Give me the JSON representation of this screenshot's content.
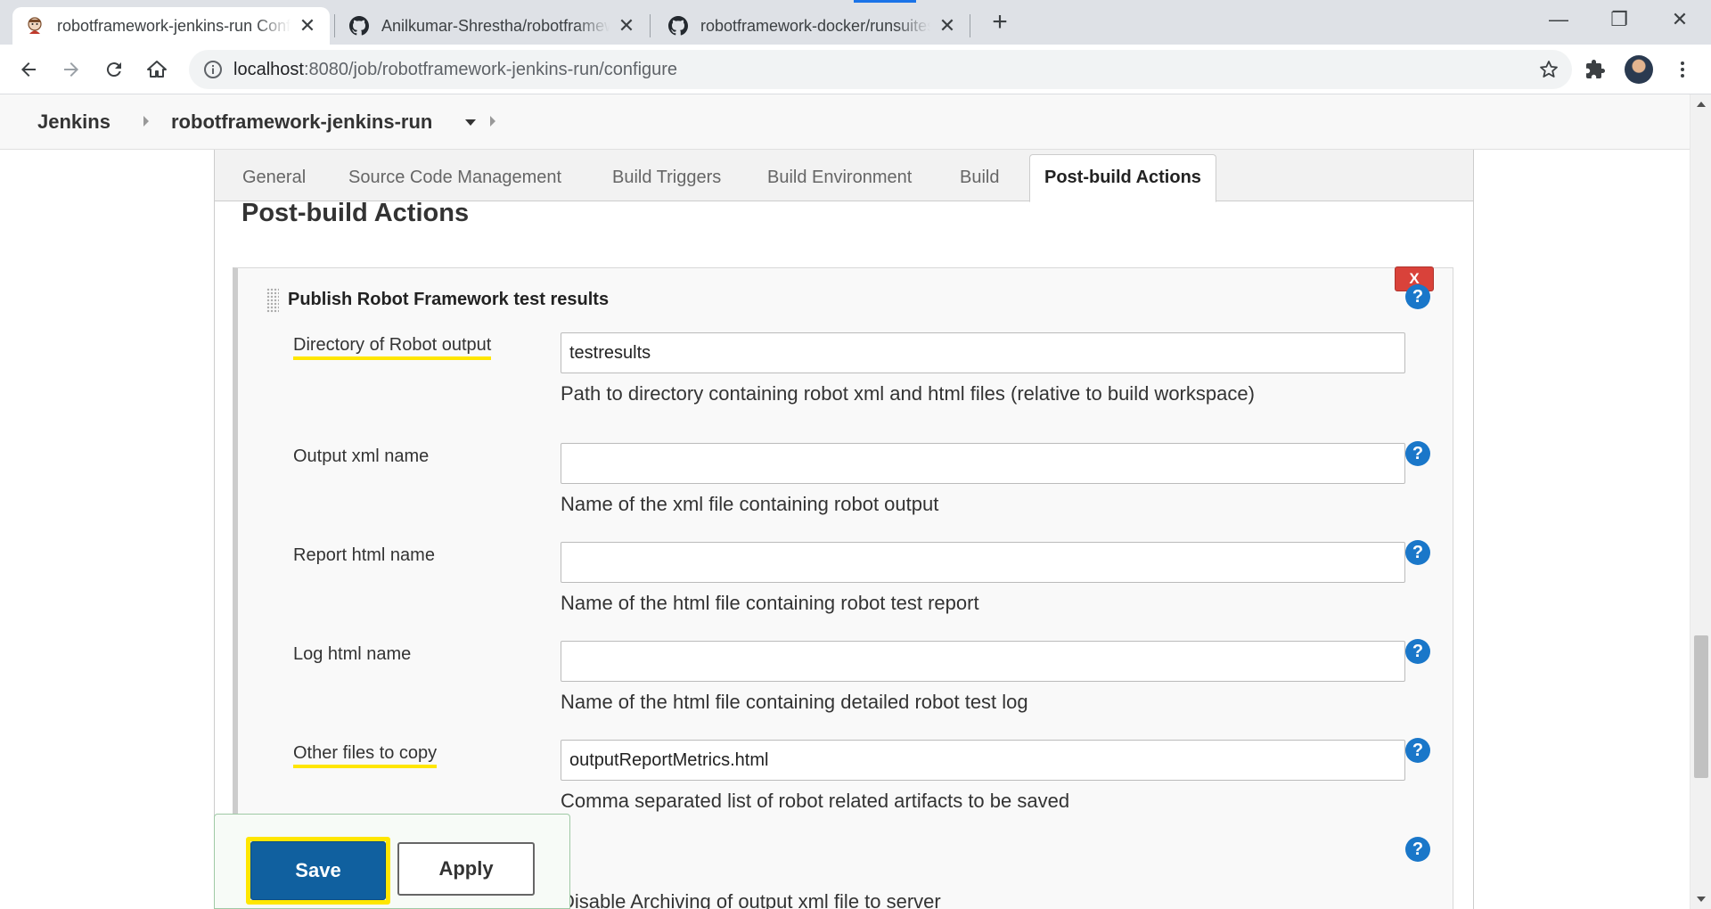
{
  "browser": {
    "tabs": [
      {
        "title": "robotframework-jenkins-run Config"
      },
      {
        "title": "Anilkumar-Shrestha/robotframework"
      },
      {
        "title": "robotframework-docker/runsuites"
      }
    ],
    "new_tab_glyph": "+",
    "close_glyph": "✕",
    "address": {
      "host": "localhost",
      "path": ":8080/job/robotframework-jenkins-run/configure"
    },
    "window_controls": {
      "minimize": "—",
      "restore": "❐",
      "close": "✕"
    }
  },
  "jenkins": {
    "breadcrumbs": {
      "home": "Jenkins",
      "job": "robotframework-jenkins-run"
    },
    "config_tabs": [
      "General",
      "Source Code Management",
      "Build Triggers",
      "Build Environment",
      "Build",
      "Post-build Actions"
    ],
    "active_tab": "Post-build Actions",
    "section_title": "Post-build Actions",
    "publisher": {
      "title": "Publish Robot Framework test results",
      "delete_label": "X",
      "help_glyph": "?",
      "fields": [
        {
          "label": "Directory of Robot output",
          "value": "testresults",
          "description": "Path to directory containing robot xml and html files (relative to build workspace)"
        },
        {
          "label": "Output xml name",
          "value": "",
          "description": "Name of the xml file containing robot output"
        },
        {
          "label": "Report html name",
          "value": "",
          "description": "Name of the html file containing robot test report"
        },
        {
          "label": "Log html name",
          "value": "",
          "description": "Name of the html file containing detailed robot test log"
        },
        {
          "label": "Other files to copy",
          "value": "outputReportMetrics.html",
          "description": "Comma separated list of robot related artifacts to be saved"
        }
      ],
      "checkbox_label": "Disable Archiving of output xml file to server"
    },
    "buttons": {
      "save": "Save",
      "apply": "Apply"
    }
  },
  "colors": {
    "highlight": "#ffe600",
    "save": "#10609f",
    "help": "#1a77c9",
    "delete": "#d9423a"
  }
}
